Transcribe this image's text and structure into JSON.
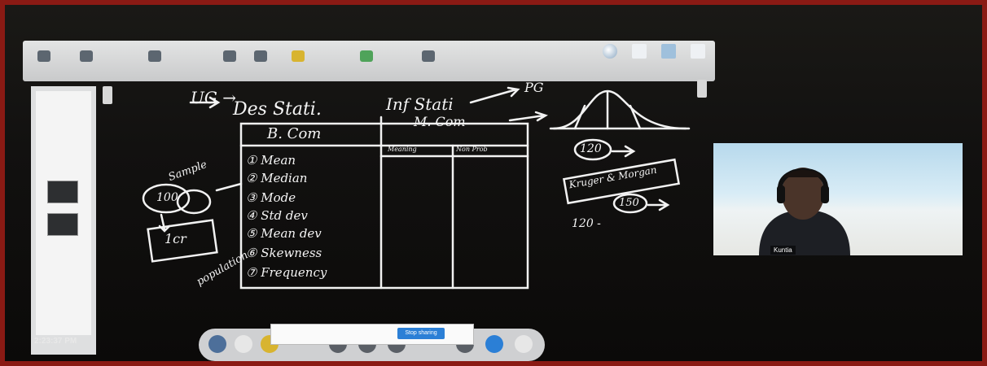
{
  "whiteboard": {
    "ug_label": "UG →",
    "des_stat_label": "Des Stati.",
    "inf_stat_label": "Inf Stati",
    "pg_label": "PG",
    "table": {
      "col1_header": "B. Com",
      "col2_header": "M. Com",
      "col2_sub1": "Meaning",
      "col2_sub2": "Non Prob",
      "rows": [
        "① Mean",
        "② Median",
        "③ Mode",
        "④ Std dev",
        "⑤ Mean dev",
        "⑥ Skewness",
        "⑦ Frequency"
      ]
    },
    "sample_label": "Sample",
    "sample_value": "100",
    "population_value": "1cr",
    "population_label": "population",
    "circle_120": "120",
    "rectangle_text": "Kruger & Morgan",
    "circle_150": "150",
    "range_prefix": "120 -"
  },
  "sidebar": {
    "clock": "2:23:37 PM"
  },
  "webcam": {
    "name_tag": "Kuntia"
  },
  "dialog": {
    "button_label": "Stop sharing"
  },
  "colors": {
    "ink": "#f4f4f4",
    "frame": "#8a1a14",
    "toolbar": "#d3d4d5",
    "accent": "#2b7fd6"
  }
}
